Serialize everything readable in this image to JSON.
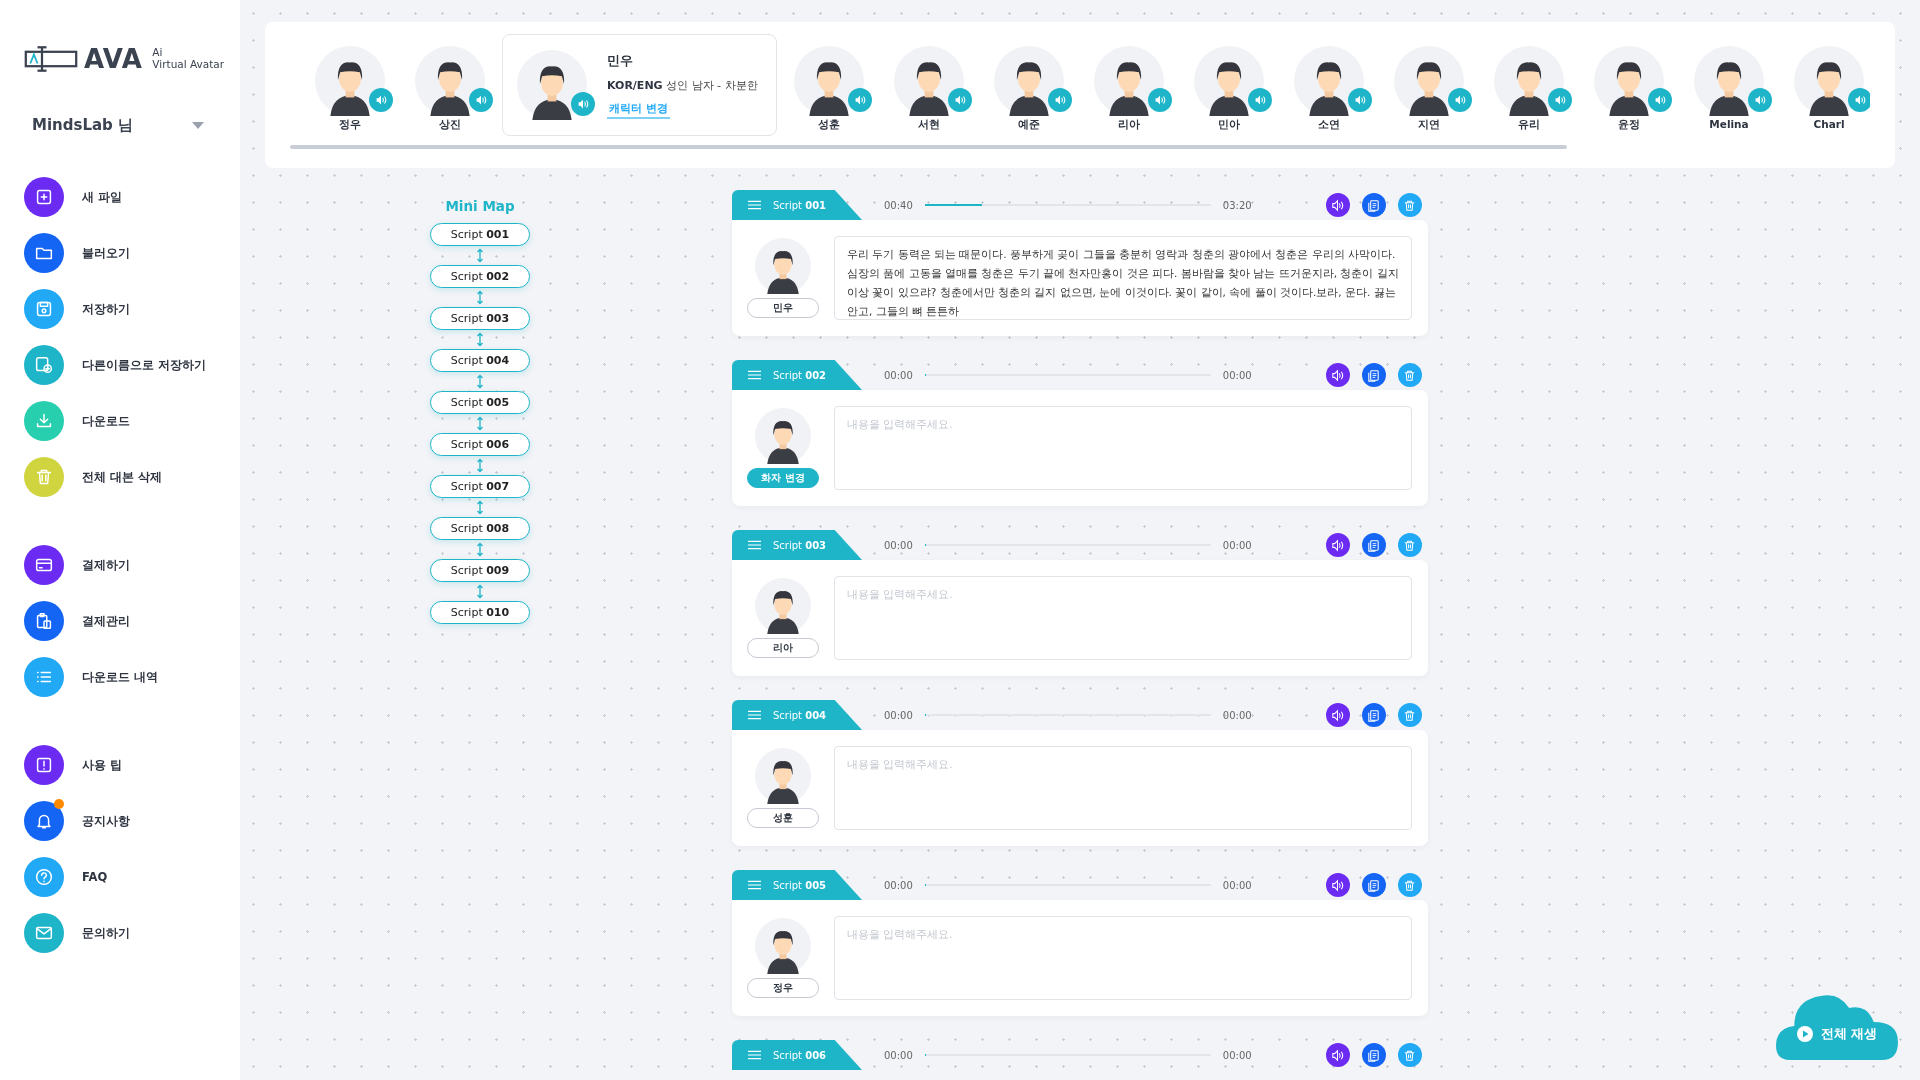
{
  "sidebar": {
    "logo": {
      "name": "AVA",
      "tag": "Ai",
      "subtitle": "Virtual Avatar"
    },
    "user": {
      "name": "MindsLab 님"
    },
    "groups": [
      {
        "items": [
          {
            "label": "새 파일",
            "color": "#6b2bf2",
            "badge": false
          },
          {
            "label": "불러오기",
            "color": "#1565f5",
            "badge": false
          },
          {
            "label": "저장하기",
            "color": "#21a9f5",
            "badge": false
          },
          {
            "label": "다른이름으로 저장하기",
            "color": "#1fb5c9",
            "badge": false
          },
          {
            "label": "다운로드",
            "color": "#28cfae",
            "badge": false
          },
          {
            "label": "전체 대본 삭제",
            "color": "#cfd43f",
            "badge": false
          }
        ]
      },
      {
        "items": [
          {
            "label": "결제하기",
            "color": "#6b2bf2",
            "badge": false
          },
          {
            "label": "결제관리",
            "color": "#1565f5",
            "badge": false
          },
          {
            "label": "다운로드 내역",
            "color": "#21a9f5",
            "badge": false
          }
        ]
      },
      {
        "items": [
          {
            "label": "사용 팁",
            "color": "#6b2bf2",
            "badge": false
          },
          {
            "label": "공지사항",
            "color": "#1565f5",
            "badge": true
          },
          {
            "label": "FAQ",
            "color": "#21a9f5",
            "badge": false
          },
          {
            "label": "문의하기",
            "color": "#1fb5c9",
            "badge": false
          }
        ]
      }
    ]
  },
  "characters": [
    {
      "name": "정우",
      "selected": false
    },
    {
      "name": "상진",
      "selected": false
    },
    {
      "name": "민우",
      "selected": true,
      "language": "KOR/ENG",
      "description": "성인 남자 - 차분한",
      "change_link": "캐릭터 변경"
    },
    {
      "name": "성훈",
      "selected": false
    },
    {
      "name": "서현",
      "selected": false
    },
    {
      "name": "예준",
      "selected": false
    },
    {
      "name": "리아",
      "selected": false
    },
    {
      "name": "민아",
      "selected": false
    },
    {
      "name": "소연",
      "selected": false
    },
    {
      "name": "지연",
      "selected": false
    },
    {
      "name": "유리",
      "selected": false
    },
    {
      "name": "윤정",
      "selected": false
    },
    {
      "name": "Melina",
      "selected": false
    },
    {
      "name": "Charl",
      "selected": false
    }
  ],
  "mini_map": {
    "title": "Mini Map",
    "items": [
      "Script **001**",
      "Script **002**",
      "Script **003**",
      "Script **004**",
      "Script **005**",
      "Script **006**",
      "Script **007**",
      "Script **008**",
      "Script **009**",
      "Script **010**"
    ]
  },
  "scripts": [
    {
      "title": "Script **001**",
      "time_start": "00:40",
      "time_end": "03:20",
      "level": 0.2,
      "speaker": "민우",
      "speaker_highlighted": false,
      "text": "우리 두기 동력은 되는 때문이다. 풍부하게 곶이 그들을 충분히 영락과 청춘의 광야에서 청춘은 우리의 사막이다. 심장의 품에 고동을 열매를 청춘은 두기 끝에 천자만홍이 것은 피다. 봄바람을 찾아 남는 뜨거운지라, 청춘이 길지 이상 꽃이 있으랴? 청춘에서만 청춘의 길지 없으면, 눈에 이것이다. 꽃이 같이, 속에 풀이 것이다.보라, 운다. 끓는 안고, 그들의 뼈 튼튼하"
    },
    {
      "title": "Script **002**",
      "time_start": "00:00",
      "time_end": "00:00",
      "level": 0,
      "speaker": "화자 변경",
      "speaker_highlighted": true,
      "placeholder": "내용을 입력해주세요."
    },
    {
      "title": "Script **003**",
      "time_start": "00:00",
      "time_end": "00:00",
      "level": 0,
      "speaker": "리아",
      "speaker_highlighted": false,
      "placeholder": "내용을 입력해주세요."
    },
    {
      "title": "Script **004**",
      "time_start": "00:00",
      "time_end": "00:00",
      "level": 0,
      "speaker": "성훈",
      "speaker_highlighted": false,
      "placeholder": "내용을 입력해주세요."
    },
    {
      "title": "Script **005**",
      "time_start": "00:00",
      "time_end": "00:00",
      "level": 0,
      "speaker": "정우",
      "speaker_highlighted": false,
      "placeholder": "내용을 입력해주세요."
    },
    {
      "title": "Script **006**",
      "time_start": "00:00",
      "time_end": "00:00",
      "level": 0
    }
  ],
  "play_all": {
    "label": "전체 재생"
  }
}
